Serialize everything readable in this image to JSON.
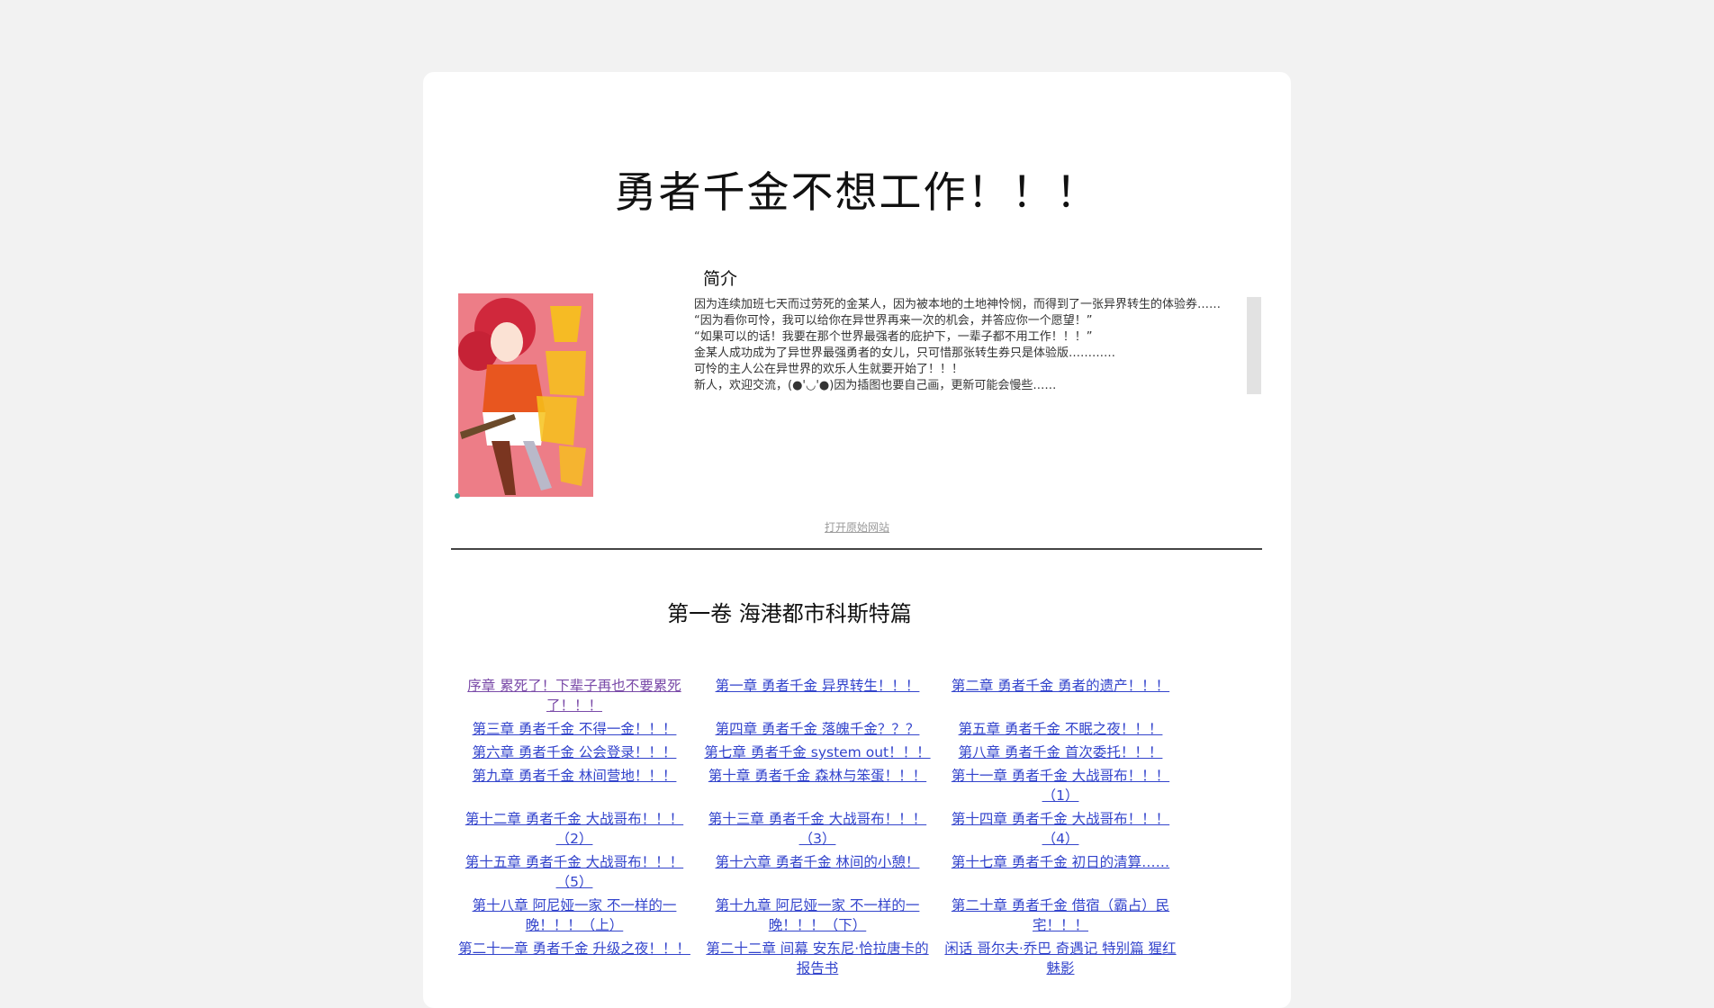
{
  "book": {
    "title": "勇者千金不想工作！！！",
    "cover_text": "勇者千金不想工作！！"
  },
  "intro": {
    "heading": "简介",
    "lines": [
      "因为连续加班七天而过劳死的金某人，因为被本地的土地神怜悯，而得到了一张异界转生的体验券……",
      "“因为看你可怜，我可以给你在异世界再来一次的机会，并答应你一个愿望！”",
      "“如果可以的话！我要在那个世界最强者的庇护下，一辈子都不用工作！！！”",
      "金某人成功成为了异世界最强勇者的女儿，只可惜那张转生券只是体验版…………",
      "可怜的主人公在异世界的欢乐人生就要开始了！！！",
      "新人，欢迎交流，(●'◡'●)因为插图也要自己画，更新可能会慢些……"
    ]
  },
  "links": {
    "origin": "打开原始网站"
  },
  "volume": {
    "title": "第一卷 海港都市科斯特篇",
    "chapters": [
      "序章 累死了！下辈子再也不要累死了！！！",
      "第一章 勇者千金 异界转生！！！",
      "第二章 勇者千金 勇者的遗产！！！",
      "第三章 勇者千金 不得一金！！！",
      "第四章 勇者千金 落魄千金？？？",
      "第五章 勇者千金 不眠之夜！！！",
      "第六章 勇者千金 公会登录！！！",
      "第七章 勇者千金 system out！！！",
      "第八章 勇者千金 首次委托！！！",
      "第九章 勇者千金 林间营地！！！",
      "第十章 勇者千金 森林与笨蛋！！！",
      "第十一章 勇者千金 大战哥布！！！（1）",
      "第十二章 勇者千金 大战哥布！！！（2）",
      "第十三章 勇者千金 大战哥布！！！（3）",
      "第十四章 勇者千金 大战哥布！！！（4）",
      "第十五章 勇者千金 大战哥布！！！（5）",
      "第十六章 勇者千金 林间的小憩！",
      "第十七章 勇者千金 初日的清算……",
      "第十八章 阿尼娅一家 不一样的一晚！！！（上）",
      "第十九章 阿尼娅一家 不一样的一晚！！！（下）",
      "第二十章 勇者千金 借宿（霸占）民宅！！！",
      "第二十一章 勇者千金 升级之夜！！！",
      "第二十二章 间幕 安东尼·恰拉唐卡的报告书",
      "闲话 哥尔夫·乔巴 奇遇记 特别篇 猩红魅影"
    ]
  },
  "colors": {
    "link": "#3344cc",
    "visited_link": "#7a4aa8",
    "page_bg": "#f2f2f2"
  }
}
